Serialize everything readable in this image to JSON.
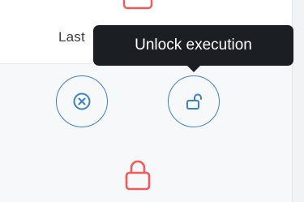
{
  "table": {
    "column_header": "Last"
  },
  "actions": {
    "cancel_icon": "circle-x-icon",
    "unlock_icon": "unlock-icon"
  },
  "status": {
    "locked_icon": "lock-icon"
  },
  "tooltip": {
    "text": "Unlock execution"
  },
  "colors": {
    "action_blue": "#3b82c4",
    "lock_red": "#f05a5a",
    "tooltip_bg": "#1b1f24"
  }
}
